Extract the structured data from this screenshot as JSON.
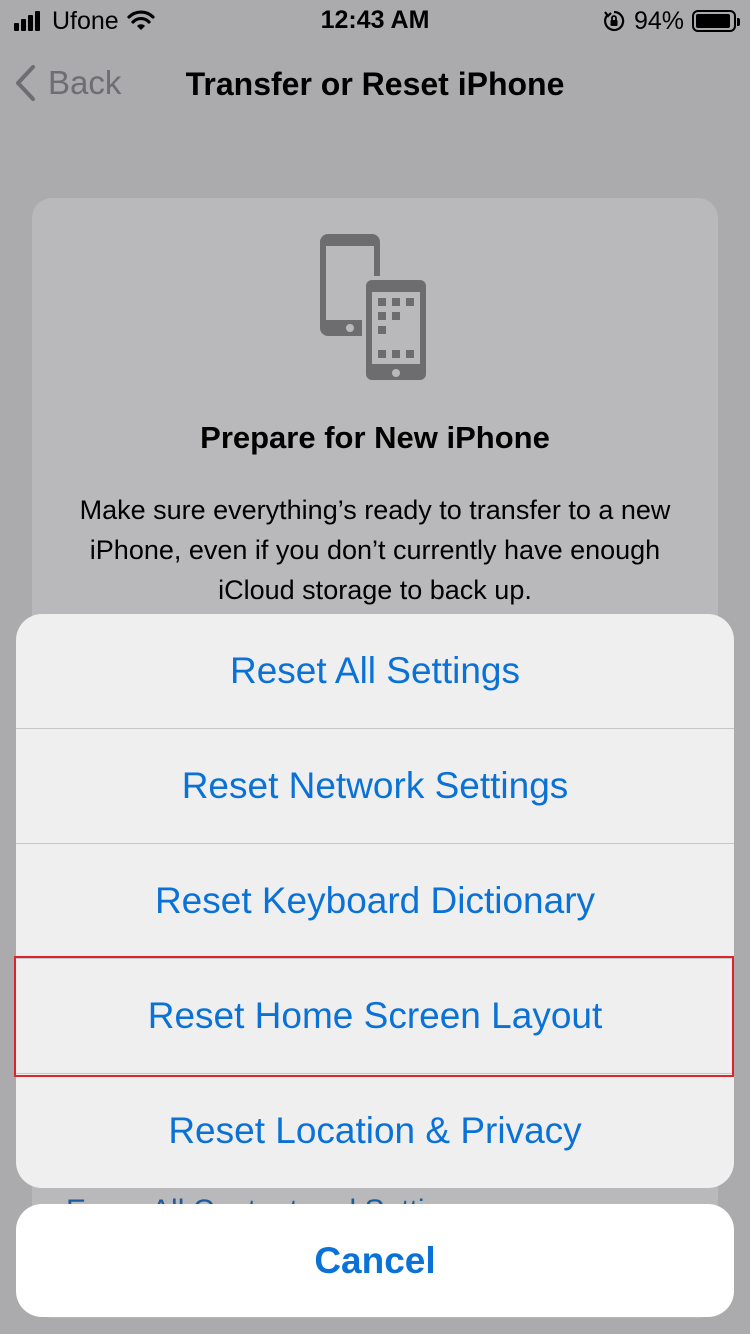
{
  "status_bar": {
    "carrier": "Ufone",
    "time": "12:43 AM",
    "battery_percent": "94%",
    "battery_level": 0.94,
    "icons": [
      "signal-icon",
      "wifi-icon",
      "orientation-lock-icon",
      "battery-icon"
    ]
  },
  "nav": {
    "back_label": "Back",
    "title": "Transfer or Reset iPhone"
  },
  "card": {
    "icon": "devices-icon",
    "title": "Prepare for New iPhone",
    "body": "Make sure everything’s ready to transfer to a new iPhone, even if you don’t currently have enough iCloud storage to back up.",
    "peek_text": "Erase All Content and Settings"
  },
  "action_sheet": {
    "items": [
      {
        "label": "Reset All Settings"
      },
      {
        "label": "Reset Network Settings"
      },
      {
        "label": "Reset Keyboard Dictionary"
      },
      {
        "label": "Reset Home Screen Layout",
        "highlighted": true
      },
      {
        "label": "Reset Location & Privacy"
      }
    ],
    "cancel_label": "Cancel"
  },
  "colors": {
    "accent": "#0a72d6",
    "highlight_border": "#d9252b",
    "dimmed_background": "#ababad"
  }
}
